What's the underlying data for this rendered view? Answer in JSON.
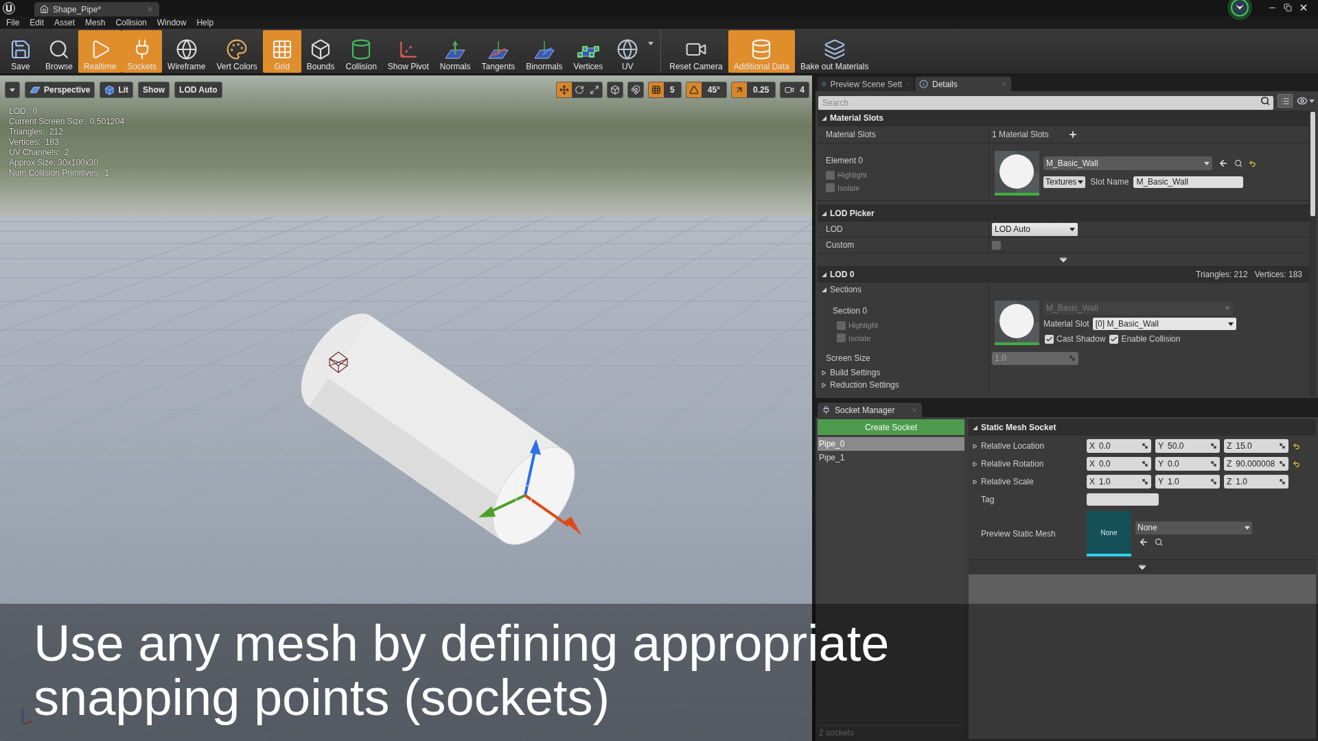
{
  "title_bar": {
    "tab": "Shape_Pipe*"
  },
  "menu": [
    "File",
    "Edit",
    "Asset",
    "Mesh",
    "Collision",
    "Window",
    "Help"
  ],
  "toolbar_groups": [
    {
      "items": [
        {
          "kind": "save",
          "label": "Save",
          "active": false
        },
        {
          "kind": "browse",
          "label": "Browse",
          "active": false
        },
        {
          "kind": "realtime",
          "label": "Realtime",
          "active": true
        },
        {
          "kind": "sockets",
          "label": "Sockets",
          "active": true
        },
        {
          "kind": "wireframe",
          "label": "Wireframe",
          "active": false
        },
        {
          "kind": "vert_colors",
          "label": "Vert Colors",
          "active": false
        },
        {
          "kind": "grid",
          "label": "Grid",
          "active": true
        },
        {
          "kind": "bounds",
          "label": "Bounds",
          "active": false
        },
        {
          "kind": "collision",
          "label": "Collision",
          "active": false
        },
        {
          "kind": "pivot",
          "label": "Show Pivot",
          "active": false
        },
        {
          "kind": "normals",
          "label": "Normals",
          "active": false
        },
        {
          "kind": "tangents",
          "label": "Tangents",
          "active": false
        },
        {
          "kind": "binormals",
          "label": "Binormals",
          "active": false
        },
        {
          "kind": "vertices",
          "label": "Vertices",
          "active": false
        },
        {
          "kind": "uv",
          "label": "UV",
          "active": false
        }
      ]
    },
    {
      "items": [
        {
          "kind": "camera",
          "label": "Reset Camera",
          "active": false
        },
        {
          "kind": "additional",
          "label": "Additional Data",
          "active": true
        },
        {
          "kind": "bake",
          "label": "Bake out Materials",
          "active": false
        }
      ]
    }
  ],
  "viewport": {
    "toolbar": [
      {
        "kind": "options"
      },
      {
        "kind": "perspective",
        "label": "Perspective"
      },
      {
        "kind": "lit",
        "label": "Lit"
      },
      {
        "kind": "plain",
        "label": "Show"
      },
      {
        "kind": "plain",
        "label": "LOD Auto"
      }
    ],
    "transform_modes": [
      {
        "kind": "translate",
        "selected": true
      },
      {
        "kind": "rotate",
        "selected": false
      },
      {
        "kind": "scale",
        "selected": false
      }
    ],
    "snaps": [
      {
        "kind": "surface",
        "active": false
      },
      {
        "kind": "grid",
        "active": true,
        "value": "5"
      },
      {
        "kind": "rotation",
        "active": true,
        "value": "45°"
      },
      {
        "kind": "scale",
        "active": true,
        "value": "0.25"
      }
    ],
    "camera_speed": "4",
    "stats": [
      "LOD:  0",
      "Current Screen Size:  0.501204",
      "Triangles:  212",
      "Vertices:  183",
      "UV Channels:  2",
      "Approx Size: 30x100x30",
      "Num Collision Primitives:  1"
    ]
  },
  "details": {
    "tabs": [
      {
        "label": "Preview Scene Sett",
        "selected": false
      },
      {
        "label": "Details",
        "selected": true
      }
    ],
    "search": {
      "placeholder": "Search"
    }
  },
  "material_slots": {
    "header": {
      "title": "Material Slots",
      "expanded": true
    },
    "label": "Material Slots",
    "count": "1 Material Slots",
    "element": {
      "label": "Element 0",
      "options": [
        {
          "label": "Highlight",
          "checked": false
        },
        {
          "label": "Isolate",
          "checked": false
        }
      ],
      "material": {
        "value": "M_Basic_Wall",
        "disabled": false
      },
      "textures": "Textures",
      "slot_name_label": "Slot Name",
      "slot_name": "M_Basic_Wall"
    }
  },
  "lod_picker": {
    "header": {
      "title": "LOD Picker",
      "expanded": true
    },
    "rows": [
      {
        "kind": "dropdown",
        "label": "LOD",
        "value": "LOD Auto"
      },
      {
        "kind": "checkbox",
        "label": "Custom",
        "checked": false
      }
    ]
  },
  "lod_0": {
    "header": {
      "title": "LOD 0",
      "expanded": true
    },
    "triangles": "Triangles: 212",
    "vertices": "Vertices: 183",
    "sections": {
      "title": "Sections",
      "expanded": true
    },
    "section": {
      "label": "Section 0",
      "options": [
        {
          "label": "Highlight",
          "checked": false
        },
        {
          "label": "Isolate",
          "checked": false
        }
      ],
      "material": {
        "value": "M_Basic_Wall",
        "disabled": true
      },
      "material_slot_label": "Material Slot",
      "material_slot": "[0] M_Basic_Wall",
      "flags": [
        {
          "label": "Cast Shadow",
          "checked": true
        },
        {
          "label": "Enable Collision",
          "checked": true
        }
      ]
    },
    "screen_size": {
      "label": "Screen Size",
      "value": "1.0",
      "disabled": true
    },
    "groups": [
      {
        "title": "Build Settings",
        "expanded": false
      },
      {
        "title": "Reduction Settings",
        "expanded": false
      }
    ]
  },
  "socket_manager": {
    "tab": "Socket Manager",
    "create_button": "Create Socket",
    "sockets": [
      {
        "name": "Pipe_0",
        "selected": true
      },
      {
        "name": "Pipe_1",
        "selected": false
      }
    ],
    "footer": "2 sockets",
    "header": {
      "title": "Static Mesh Socket",
      "expanded": true
    },
    "transforms": [
      {
        "label": "Relative Location",
        "expanded": false,
        "modified": true,
        "values": [
          {
            "axis": "X",
            "value": "0.0"
          },
          {
            "axis": "Y",
            "value": "50.0"
          },
          {
            "axis": "Z",
            "value": "15.0"
          }
        ]
      },
      {
        "label": "Relative Rotation",
        "expanded": false,
        "modified": true,
        "values": [
          {
            "axis": "X",
            "value": "0.0"
          },
          {
            "axis": "Y",
            "value": "0.0"
          },
          {
            "axis": "Z",
            "value": "90.000008"
          }
        ]
      },
      {
        "label": "Relative Scale",
        "expanded": false,
        "modified": false,
        "values": [
          {
            "axis": "X",
            "value": "1.0"
          },
          {
            "axis": "Y",
            "value": "1.0"
          },
          {
            "axis": "Z",
            "value": "1.0"
          }
        ]
      }
    ],
    "tag_label": "Tag",
    "preview": {
      "label": "Preview Static Mesh",
      "thumbnail": "None",
      "value": "None"
    }
  },
  "caption": "Use any mesh by defining appropriate snapping points (sockets)"
}
